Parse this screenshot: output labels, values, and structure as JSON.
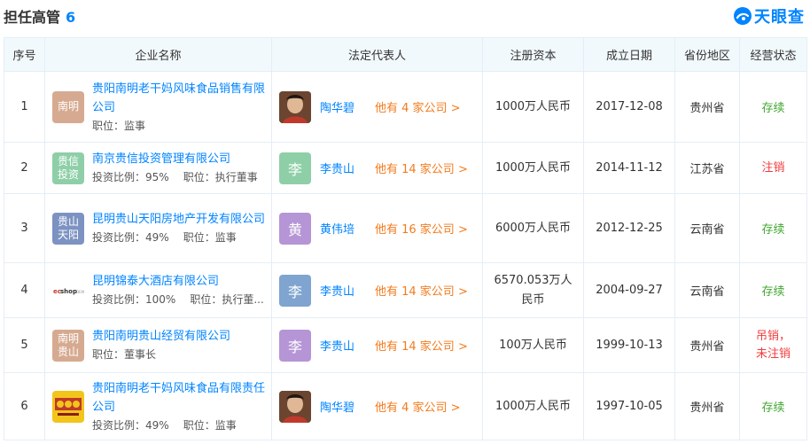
{
  "header": {
    "title": "担任高管",
    "count": "6",
    "brand": "天眼查"
  },
  "columns": [
    "序号",
    "企业名称",
    "法定代表人",
    "注册资本",
    "成立日期",
    "省份地区",
    "经营状态"
  ],
  "rows": [
    {
      "index": "1",
      "logo": {
        "text": "南明",
        "color": "#d6aa90",
        "icon": "text-logo"
      },
      "company": "贵阳南明老干妈风味食品销售有限公司",
      "ratio": "",
      "position": "职位：监事",
      "rep_avatar": {
        "text": "",
        "color": "#8a5a3c",
        "icon": "person-photo"
      },
      "rep_name": "陶华碧",
      "rep_more": "他有 4 家公司 >",
      "capital": "1000万人民币",
      "date": "2017-12-08",
      "region": "贵州省",
      "status": "存续",
      "status_type": "ok"
    },
    {
      "index": "2",
      "logo": {
        "text": "贵信投资",
        "color": "#8fcfa8",
        "icon": "text-logo"
      },
      "company": "南京贵信投资管理有限公司",
      "ratio": "投资比例：95%",
      "position": "职位：执行董事",
      "rep_avatar": {
        "text": "李",
        "color": "#8fcfa8",
        "icon": "text-avatar"
      },
      "rep_name": "李贵山",
      "rep_more": "他有 14 家公司 >",
      "capital": "1000万人民币",
      "date": "2014-11-12",
      "region": "江苏省",
      "status": "注销",
      "status_type": "bad"
    },
    {
      "index": "3",
      "logo": {
        "text": "贵山天阳",
        "color": "#7c93c2",
        "icon": "text-logo"
      },
      "company": "昆明贵山天阳房地产开发有限公司",
      "ratio": "投资比例：49%",
      "position": "职位：监事",
      "rep_avatar": {
        "text": "黄",
        "color": "#b595d6",
        "icon": "text-avatar"
      },
      "rep_name": "黄伟培",
      "rep_more": "他有 16 家公司 >",
      "capital": "6000万人民币",
      "date": "2012-12-25",
      "region": "云南省",
      "status": "存续",
      "status_type": "ok"
    },
    {
      "index": "4",
      "logo": {
        "text": "ecshop",
        "color": "#ffffff",
        "icon": "ecshop-logo"
      },
      "company": "昆明锦泰大酒店有限公司",
      "ratio": "投资比例：100%",
      "position": "职位：执行董...",
      "rep_avatar": {
        "text": "李",
        "color": "#7ea4cf",
        "icon": "text-avatar"
      },
      "rep_name": "李贵山",
      "rep_more": "他有 14 家公司 >",
      "capital": "6570.053万人民币",
      "date": "2004-09-27",
      "region": "云南省",
      "status": "存续",
      "status_type": "ok"
    },
    {
      "index": "5",
      "logo": {
        "text": "南明贵山",
        "color": "#d6aa90",
        "icon": "text-logo"
      },
      "company": "贵阳南明贵山经贸有限公司",
      "ratio": "",
      "position": "职位：董事长",
      "rep_avatar": {
        "text": "李",
        "color": "#b595d6",
        "icon": "text-avatar"
      },
      "rep_name": "李贵山",
      "rep_more": "他有 14 家公司 >",
      "capital": "100万人民币",
      "date": "1999-10-13",
      "region": "贵州省",
      "status": "吊销，未注销",
      "status_type": "bad"
    },
    {
      "index": "6",
      "logo": {
        "text": "老干妈",
        "color": "#f2c51a",
        "icon": "laoganma-logo"
      },
      "company": "贵阳南明老干妈风味食品有限责任公司",
      "ratio": "投资比例：49%",
      "position": "职位：监事",
      "rep_avatar": {
        "text": "",
        "color": "#8a5a3c",
        "icon": "person-photo"
      },
      "rep_name": "陶华碧",
      "rep_more": "他有 4 家公司 >",
      "capital": "1000万人民币",
      "date": "1997-10-05",
      "region": "贵州省",
      "status": "存续",
      "status_type": "ok"
    }
  ]
}
